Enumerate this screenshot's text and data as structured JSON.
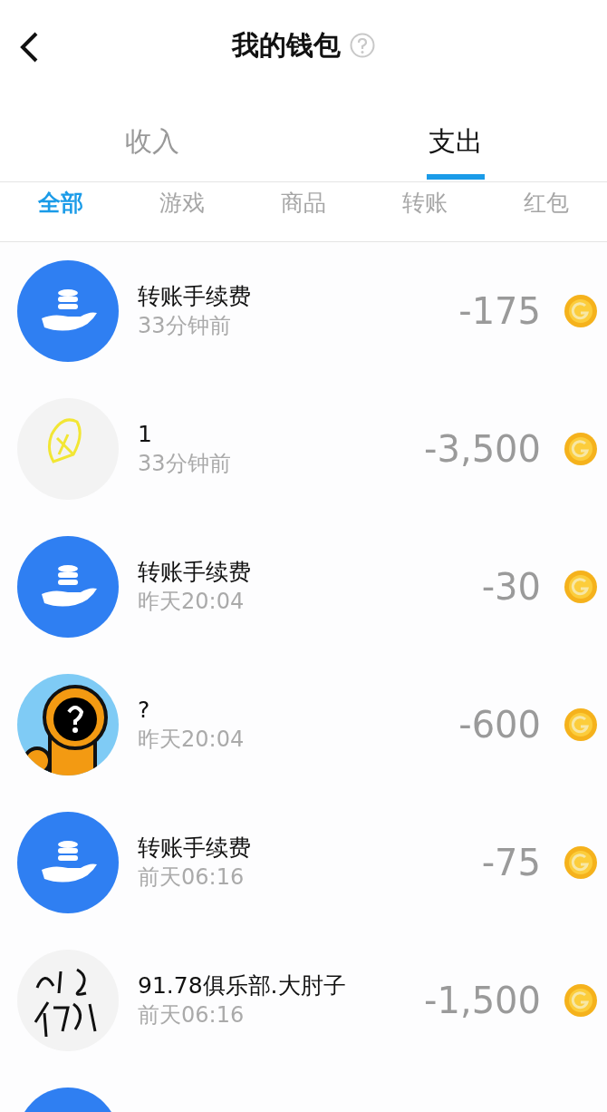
{
  "header": {
    "title": "我的钱包"
  },
  "tabs": [
    {
      "label": "收入",
      "selected": false
    },
    {
      "label": "支出",
      "selected": true
    }
  ],
  "filters": [
    {
      "label": "全部",
      "selected": true
    },
    {
      "label": "游戏",
      "selected": false
    },
    {
      "label": "商品",
      "selected": false
    },
    {
      "label": "转账",
      "selected": false
    },
    {
      "label": "红包",
      "selected": false
    }
  ],
  "transactions": [
    {
      "kind": "transfer",
      "title": "转账手续费",
      "time": "33分钟前",
      "amount": "-175"
    },
    {
      "kind": "picture",
      "title": "1",
      "time": "33分钟前",
      "amount": "-3,500"
    },
    {
      "kind": "transfer",
      "title": "转账手续费",
      "time": "昨天20:04",
      "amount": "-30"
    },
    {
      "kind": "picture",
      "title": "?",
      "time": "昨天20:04",
      "amount": "-600"
    },
    {
      "kind": "transfer",
      "title": "转账手续费",
      "time": "前天06:16",
      "amount": "-75"
    },
    {
      "kind": "picture",
      "title": "91.78俱乐部.大肘子",
      "time": "前天06:16",
      "amount": "-1,500"
    },
    {
      "kind": "transfer"
    }
  ]
}
